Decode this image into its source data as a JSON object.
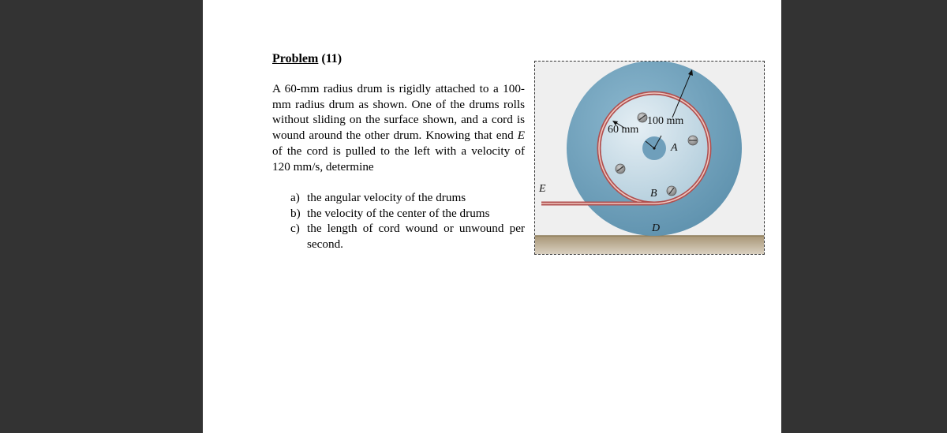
{
  "problem": {
    "title_word": "Problem",
    "title_number": "(11)",
    "para_part1": "A 60-mm radius drum is rigidly attached to a 100-mm radius drum as shown. One of the drums rolls without sliding on the surface shown, and a cord is wound around the other drum. Knowing that end ",
    "para_var": "E",
    "para_part2": " of the cord is pulled to the left with a velocity of 120 mm/s, determine",
    "items": [
      {
        "marker": "a)",
        "text": "the angular velocity of the drums"
      },
      {
        "marker": "b)",
        "text": "the velocity of the center of the drums"
      },
      {
        "marker": "c)",
        "text": "the length of cord wound or unwound per second."
      }
    ]
  },
  "figure": {
    "labels": {
      "inner_radius": "60 mm",
      "outer_radius": "100 mm",
      "center": "A",
      "cord_contact": "B",
      "ground_contact": "D",
      "cord_end": "E"
    },
    "colors": {
      "outer_drum": "#6e9fbb",
      "inner_drum": "#c9dde8",
      "hub": "#7aaac4",
      "cord": "#b85a5a",
      "ground": "#b5a58a",
      "frame_bg": "#efefef"
    }
  }
}
